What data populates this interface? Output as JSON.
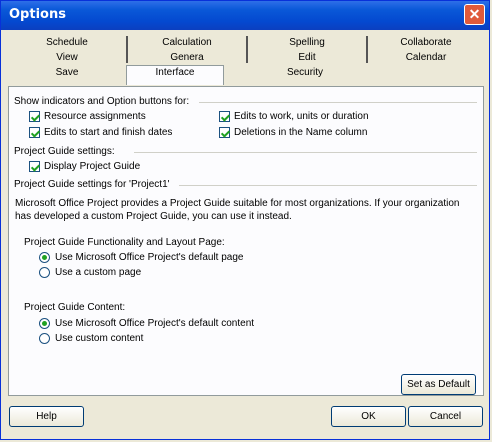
{
  "window": {
    "title": "Options",
    "close_glyph": "✕"
  },
  "tabs": {
    "row1": [
      "Schedule",
      "Calculation",
      "Spelling",
      "Collaborate"
    ],
    "row2": [
      "View",
      "Genera",
      "Edit",
      "Calendar"
    ],
    "row3": [
      "Save",
      "Interface",
      "Security"
    ],
    "active": "Interface"
  },
  "indicators": {
    "heading": "Show indicators and Option buttons for:",
    "items": [
      {
        "label": "Resource assignments",
        "checked": true
      },
      {
        "label": "Edits to work, units or duration",
        "checked": true
      },
      {
        "label": "Edits to start and finish dates",
        "checked": true
      },
      {
        "label": "Deletions in the Name column",
        "checked": true
      }
    ]
  },
  "guide_settings": {
    "heading": "Project Guide settings:",
    "display_label": "Display Project Guide",
    "display_checked": true
  },
  "guide_for_project": {
    "heading": "Project Guide settings for 'Project1'",
    "description_line1": "Microsoft Office Project provides a Project Guide suitable for most organizations. If your organization",
    "description_line2": "has developed a custom Project Guide, you can use it instead.",
    "functionality_heading": "Project Guide Functionality and Layout Page:",
    "functionality_options": [
      {
        "label": "Use Microsoft Office Project's default page",
        "selected": true
      },
      {
        "label": "Use a custom page",
        "selected": false
      }
    ],
    "content_heading": "Project Guide Content:",
    "content_options": [
      {
        "label": "Use Microsoft Office Project's default content",
        "selected": true
      },
      {
        "label": "Use custom content",
        "selected": false
      }
    ],
    "set_default_label": "Set as Default"
  },
  "footer": {
    "help_label": "Help",
    "ok_label": "OK",
    "cancel_label": "Cancel"
  }
}
